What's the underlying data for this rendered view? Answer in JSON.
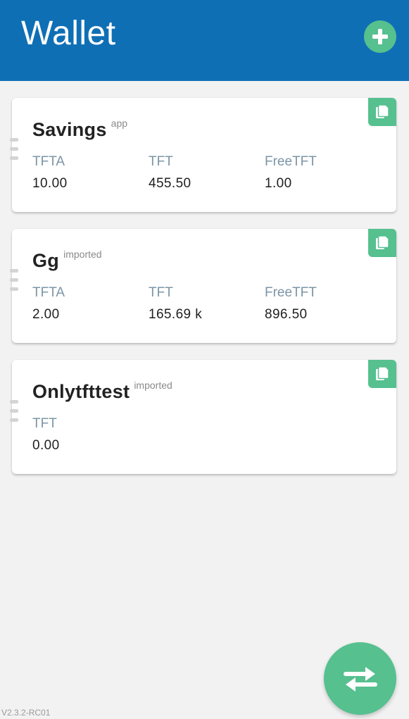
{
  "header": {
    "title": "Wallet",
    "add_icon": "plus-icon"
  },
  "colors": {
    "header_bg": "#0f6fb5",
    "accent": "#56c08f",
    "background": "#f2f2f2",
    "label": "#7c95a6"
  },
  "wallets": [
    {
      "name": "Savings",
      "tag": "app",
      "balances": [
        {
          "label": "TFTA",
          "value": "10.00"
        },
        {
          "label": "TFT",
          "value": "455.50"
        },
        {
          "label": "FreeTFT",
          "value": "1.00"
        }
      ]
    },
    {
      "name": "Gg",
      "tag": "imported",
      "balances": [
        {
          "label": "TFTA",
          "value": "2.00"
        },
        {
          "label": "TFT",
          "value": "165.69 k"
        },
        {
          "label": "FreeTFT",
          "value": "896.50"
        }
      ]
    },
    {
      "name": "Onlytfttest",
      "tag": "imported",
      "balances": [
        {
          "label": "TFT",
          "value": "0.00"
        }
      ]
    }
  ],
  "fab": {
    "icon": "swap-arrows-icon"
  },
  "footer": {
    "version": "V2.3.2-RC01"
  }
}
